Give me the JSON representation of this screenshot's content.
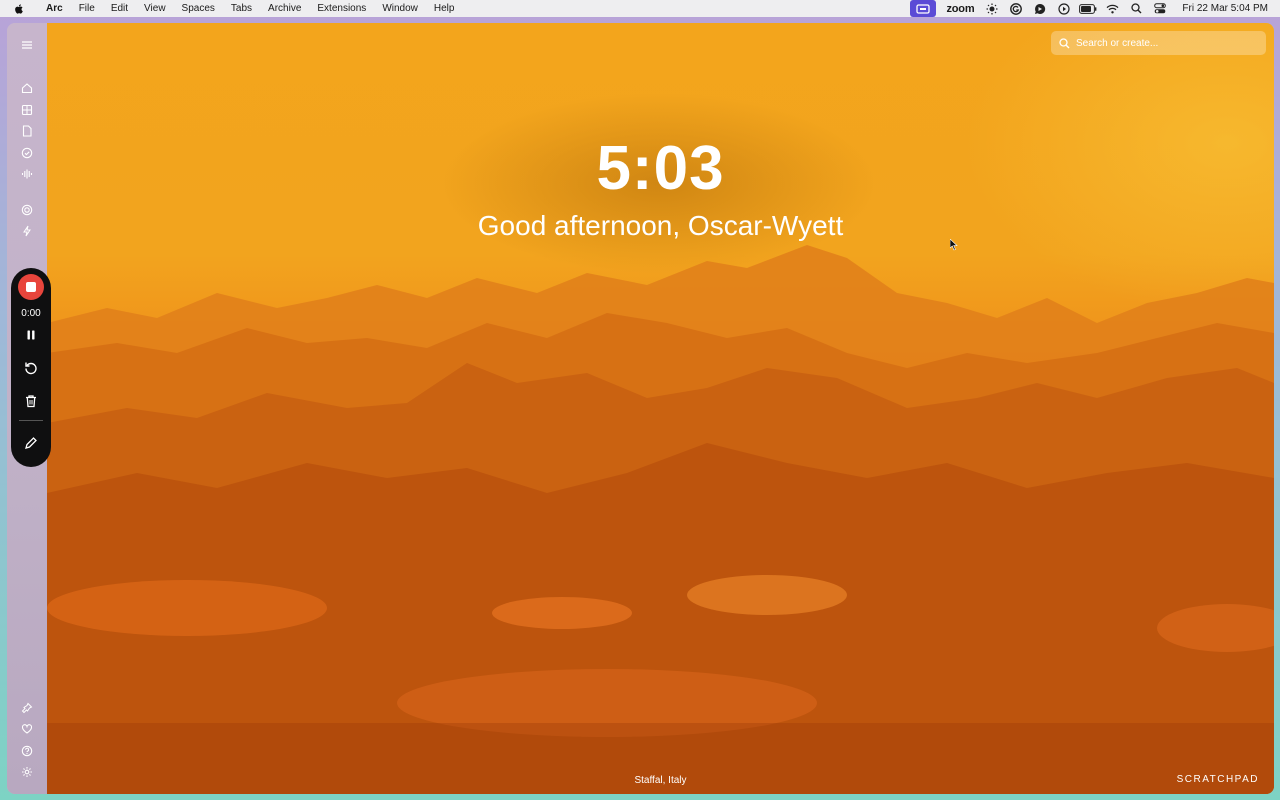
{
  "menubar": {
    "app_name": "Arc",
    "items": [
      "File",
      "Edit",
      "View",
      "Spaces",
      "Tabs",
      "Archive",
      "Extensions",
      "Window",
      "Help"
    ],
    "zoom_label": "zoom",
    "datetime": "Fri 22 Mar  5:04 PM"
  },
  "sidebar": {
    "icons": [
      "menu-icon",
      "home-icon",
      "grid-icon",
      "document-icon",
      "check-circle-icon",
      "audio-icon",
      "target-icon",
      "bolt-icon",
      "pin-icon",
      "heart-icon",
      "help-icon",
      "settings-icon"
    ]
  },
  "newtab": {
    "time": "5:03",
    "greeting": "Good afternoon, Oscar-Wyett",
    "search_placeholder": "Search or create...",
    "location": "Staffal, Italy",
    "brand": "SCRATCHPAD"
  },
  "recorder": {
    "elapsed": "0:00",
    "record_color": "#e8453c"
  },
  "colors": {
    "accent_status": "#5b4bd6",
    "sky_top": "#f3a51c",
    "valley_bottom": "#a9400a"
  }
}
